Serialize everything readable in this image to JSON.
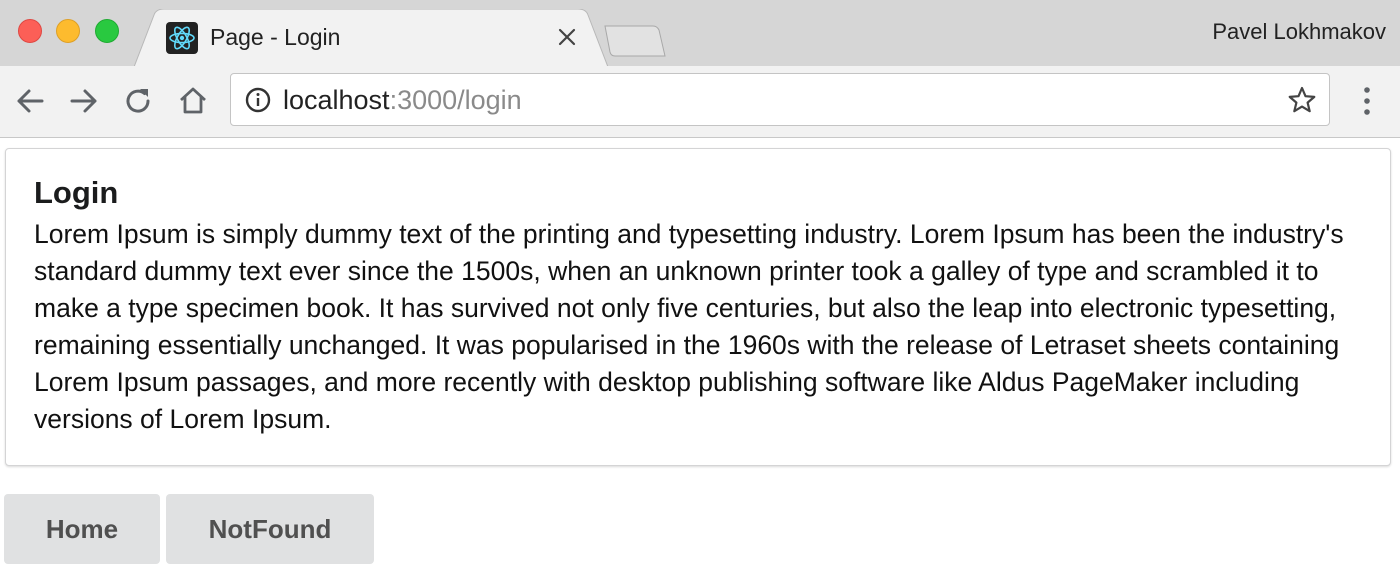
{
  "window": {
    "profile_name": "Pavel Lokhmakov"
  },
  "tab": {
    "title": "Page - Login",
    "icon": "react-logo-icon"
  },
  "address_bar": {
    "host": "localhost",
    "path": ":3000/login"
  },
  "page": {
    "heading": "Login",
    "body": "Lorem Ipsum is simply dummy text of the printing and typesetting industry. Lorem Ipsum has been the industry's standard dummy text ever since the 1500s, when an unknown printer took a galley of type and scrambled it to make a type specimen book. It has survived not only five centuries, but also the leap into electronic typesetting, remaining essentially unchanged. It was popularised in the 1960s with the release of Letraset sheets containing Lorem Ipsum passages, and more recently with desktop publishing software like Aldus PageMaker including versions of Lorem Ipsum.",
    "buttons": {
      "home": "Home",
      "notfound": "NotFound"
    }
  },
  "colors": {
    "titlebar": "#d6d6d6",
    "toolbar": "#f2f2f2",
    "react_blue": "#61dafb",
    "button_bg": "#e0e1e2"
  }
}
